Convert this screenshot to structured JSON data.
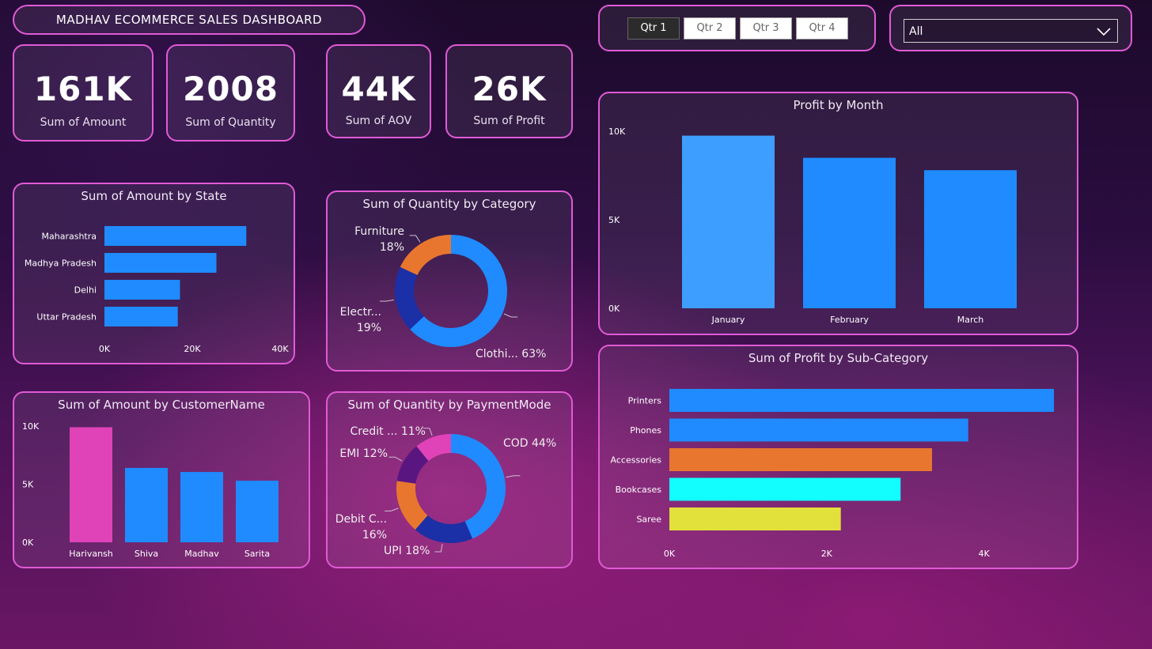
{
  "dashboard_title": "MADHAV ECOMMERCE SALES DASHBOARD",
  "slicer": {
    "quarters": [
      "Qtr 1",
      "Qtr 2",
      "Qtr 3",
      "Qtr 4"
    ],
    "active_quarter": "Qtr 1",
    "state_dropdown_value": "All"
  },
  "kpis": [
    {
      "value": "161K",
      "label": "Sum of Amount"
    },
    {
      "value": "2008",
      "label": "Sum of Quantity"
    },
    {
      "value": "44K",
      "label": "Sum of AOV"
    },
    {
      "value": "26K",
      "label": "Sum of Profit"
    }
  ],
  "colors": {
    "bar_blue": "#1f8bff",
    "bar_light_blue": "#3d9eff",
    "pink": "#e043b8",
    "orange": "#e8762f",
    "navy": "#1b2fa6",
    "purple": "#5a1680",
    "cyan": "#12fdfd",
    "yellow": "#e2e03a",
    "panel_border": "#e05ad6"
  },
  "chart_data": [
    {
      "id": "amount_by_state",
      "type": "bar",
      "orientation": "horizontal",
      "title": "Sum of Amount by State",
      "categories": [
        "Maharashtra",
        "Madhya Pradesh",
        "Delhi",
        "Uttar Pradesh"
      ],
      "values": [
        32300,
        25500,
        17200,
        16700
      ],
      "xlim": [
        0,
        40000
      ],
      "ticks": [
        "0K",
        "20K",
        "40K"
      ],
      "tick_values": [
        0,
        20000,
        40000
      ]
    },
    {
      "id": "quantity_by_category",
      "type": "pie",
      "donut": true,
      "title": "Sum of Quantity by Category",
      "slices": [
        {
          "label": "Clothi...",
          "pct": "63%",
          "value": 63,
          "color": "#1f8bff"
        },
        {
          "label": "Electr...",
          "pct": "19%",
          "value": 19,
          "color": "#1b2fa6"
        },
        {
          "label": "Furniture",
          "pct": "18%",
          "value": 18,
          "color": "#e8762f"
        }
      ]
    },
    {
      "id": "profit_by_month",
      "type": "bar",
      "title": "Profit by Month",
      "categories": [
        "January",
        "February",
        "March"
      ],
      "values": [
        9750,
        8500,
        7800
      ],
      "ylim": [
        0,
        10000
      ],
      "ticks": [
        "0K",
        "5K",
        "10K"
      ],
      "tick_values": [
        0,
        5000,
        10000
      ]
    },
    {
      "id": "amount_by_customer",
      "type": "bar",
      "title": "Sum of Amount by CustomerName",
      "categories": [
        "Harivansh",
        "Shiva",
        "Madhav",
        "Sarita"
      ],
      "values": [
        9900,
        6400,
        6050,
        5300
      ],
      "ylim": [
        0,
        10000
      ],
      "ticks": [
        "0K",
        "5K",
        "10K"
      ],
      "tick_values": [
        0,
        5000,
        10000
      ],
      "highlight_index": 0
    },
    {
      "id": "quantity_by_paymentmode",
      "type": "pie",
      "donut": true,
      "title": "Sum of Quantity by PaymentMode",
      "slices": [
        {
          "label": "COD",
          "pct": "44%",
          "value": 44,
          "color": "#1f8bff"
        },
        {
          "label": "UPI",
          "pct": "18%",
          "value": 18,
          "color": "#1b2fa6"
        },
        {
          "label": "Debit C...",
          "pct": "16%",
          "value": 16,
          "color": "#e8762f"
        },
        {
          "label": "EMI",
          "pct": "12%",
          "value": 12,
          "color": "#5a1680"
        },
        {
          "label": "Credit ...",
          "pct": "11%",
          "value": 11,
          "color": "#e043b8"
        }
      ]
    },
    {
      "id": "profit_by_subcategory",
      "type": "bar",
      "orientation": "horizontal",
      "title": "Sum of Profit by Sub-Category",
      "categories": [
        "Printers",
        "Phones",
        "Accessories",
        "Bookcases",
        "Saree"
      ],
      "values": [
        4890,
        3800,
        3340,
        2940,
        2180
      ],
      "colors": [
        "#1f8bff",
        "#1f8bff",
        "#e8762f",
        "#12fdfd",
        "#e2e03a"
      ],
      "xlim": [
        0,
        5000
      ],
      "ticks": [
        "0K",
        "2K",
        "4K"
      ],
      "tick_values": [
        0,
        2000,
        4000
      ]
    }
  ]
}
